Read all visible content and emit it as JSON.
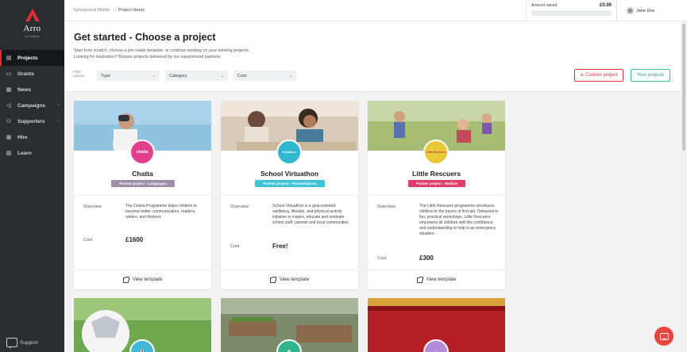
{
  "sidebar": {
    "logo_text": "Arro",
    "logo_sub": "by Teamie",
    "items": [
      {
        "label": "Projects",
        "icon": "projects-icon",
        "glyph": "▤",
        "active": true
      },
      {
        "label": "Grants",
        "icon": "grants-icon",
        "glyph": "▭",
        "active": false
      },
      {
        "label": "News",
        "icon": "news-icon",
        "glyph": "▦",
        "active": false
      },
      {
        "label": "Campaigns",
        "icon": "megaphone-icon",
        "glyph": "◁",
        "active": false
      },
      {
        "label": "Supporters",
        "icon": "supporters-icon",
        "glyph": "⚇",
        "active": false
      },
      {
        "label": "Hire",
        "icon": "hire-icon",
        "glyph": "▣",
        "active": false
      },
      {
        "label": "Learn",
        "icon": "learn-icon",
        "glyph": "▥",
        "active": false
      }
    ],
    "support_label": "Support"
  },
  "topbar": {
    "breadcrumb_root": "Springwood Middle",
    "breadcrumb_sep": "›",
    "breadcrumb_current": "Project library",
    "amount_label": "Amount raised",
    "amount_value": "£0.00",
    "user_name": "Jane Doe"
  },
  "header": {
    "title": "Get started - Choose a project",
    "desc_line1": "Start from scratch, choose a pre-made template, or continue working on your existing projects.",
    "desc_line2": "Looking for inspiration? Browse projects delivered by our experienced partners.",
    "filter_label": "Filter options",
    "filters": [
      "Type",
      "Category",
      "Cost"
    ],
    "custom_button": "Custom project",
    "yours_button": "Your projects"
  },
  "cards": [
    {
      "title": "Chatta",
      "tag": "Partner project - Languages",
      "tag_color": "#9b8ea6",
      "badge_text": "chatta",
      "badge_color": "#e0418a",
      "overview_label": "Overview",
      "overview": "The Chatta Programme helps children to become better communicators, readers, writers, and thinkers.",
      "cost_label": "Cost",
      "cost": "£1600",
      "view_label": "View template"
    },
    {
      "title": "School Virtuathon",
      "tag": "Partner project - Fitness/Sports",
      "tag_color": "#3ec3d6",
      "badge_text": "Virtuathon",
      "badge_color": "#2fb7d0",
      "overview_label": "Overview",
      "overview": "School Virtuathon is a goal-oriented, wellbeing, lifestyle, and physical activity initiative to inspire, educate and motivate school staff, parents and local communities.",
      "cost_label": "Cost",
      "cost": "Free!",
      "view_label": "View template"
    },
    {
      "title": "Little Rescuers",
      "tag": "Partner project - Welfare",
      "tag_color": "#e23d6a",
      "badge_text": "Little Rescuers",
      "badge_color": "#e8c93a",
      "overview_label": "Overview",
      "overview": "The Little Rescuers programme introduces children to the basics of first aid. Delivered in fun, practical workshops, Little Rescuers empowers all children with the confidence and understanding to help in an emergency situation.",
      "cost_label": "Cost",
      "cost": "£300",
      "view_label": "View template"
    }
  ],
  "colors": {
    "accent": "#e02d3c",
    "teal": "#3bbfa3",
    "sidebar": "#2b2d30"
  }
}
